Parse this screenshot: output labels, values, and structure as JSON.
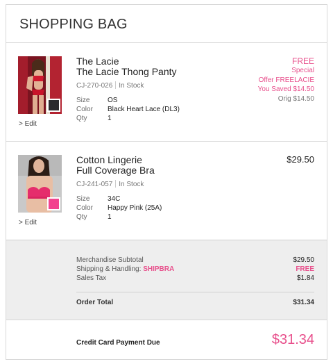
{
  "header": {
    "title": "SHOPPING BAG"
  },
  "items": [
    {
      "name_line1": "The Lacie",
      "name_line2": "The Lacie Thong Panty",
      "sku": "CJ-270-026",
      "stock": "In Stock",
      "size_label": "Size",
      "size": "OS",
      "color_label": "Color",
      "color": "Black Heart Lace (DL3)",
      "qty_label": "Qty",
      "qty": "1",
      "edit_label": "> Edit",
      "swatch_color": "#2a2a2e",
      "price_free": "FREE",
      "price_special": "Special",
      "price_offer": "Offer FREELACIE",
      "price_saved": "You Saved $14.50",
      "price_orig": "Orig $14.50"
    },
    {
      "name_line1": "Cotton Lingerie",
      "name_line2": "Full Coverage Bra",
      "sku": "CJ-241-057",
      "stock": "In Stock",
      "size_label": "Size",
      "size": "34C",
      "color_label": "Color",
      "color": "Happy Pink (25A)",
      "qty_label": "Qty",
      "qty": "1",
      "edit_label": "> Edit",
      "swatch_color": "#f2438f",
      "price": "$29.50"
    }
  ],
  "summary": {
    "merch_label": "Merchandise Subtotal",
    "merch_value": "$29.50",
    "shipping_label": "Shipping & Handling:",
    "shipping_code": "SHIPBRA",
    "shipping_value": "FREE",
    "tax_label": "Sales Tax",
    "tax_value": "$1.84",
    "total_label": "Order Total",
    "total_value": "$31.34"
  },
  "due": {
    "label": "Credit Card Payment Due",
    "amount": "$31.34"
  },
  "colors": {
    "accent": "#e8508c"
  }
}
